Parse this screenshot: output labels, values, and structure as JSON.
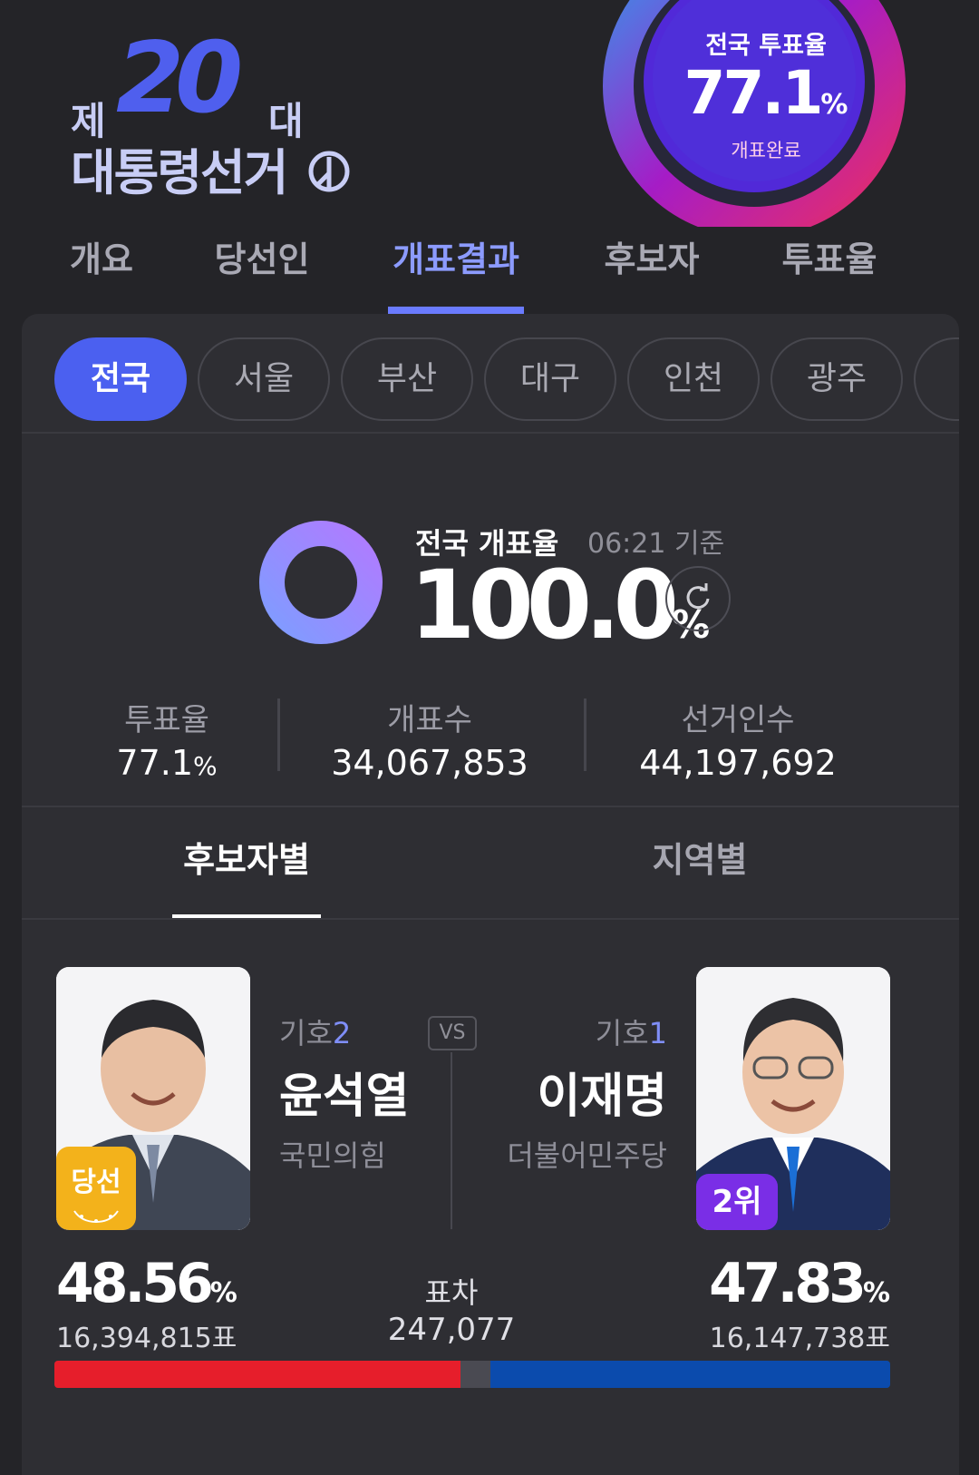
{
  "header": {
    "logo_prefix": "제",
    "logo_number": "20",
    "logo_suffix": "대",
    "logo_title": "대통령선거",
    "turnout_label": "전국 투표율",
    "turnout_value": "77.1",
    "turnout_unit": "%",
    "turnout_status": "개표완료"
  },
  "nav": {
    "tabs": [
      {
        "label": "개요"
      },
      {
        "label": "당선인"
      },
      {
        "label": "개표결과"
      },
      {
        "label": "후보자"
      },
      {
        "label": "투표율"
      }
    ],
    "active": "개표결과"
  },
  "regions": {
    "items": [
      {
        "label": "전국"
      },
      {
        "label": "서울"
      },
      {
        "label": "부산"
      },
      {
        "label": "대구"
      },
      {
        "label": "인천"
      },
      {
        "label": "광주"
      }
    ],
    "active": "전국"
  },
  "count": {
    "label": "전국 개표율",
    "time": "06:21 기준",
    "value": "100.0",
    "unit": "%",
    "progress": 1.0,
    "stats": [
      {
        "label": "투표율",
        "value": "77.1",
        "unit": "%"
      },
      {
        "label": "개표수",
        "value": "34,067,853"
      },
      {
        "label": "선거인수",
        "value": "44,197,692"
      }
    ]
  },
  "sub_tabs": {
    "tabs": [
      {
        "label": "후보자별"
      },
      {
        "label": "지역별"
      }
    ],
    "active": "후보자별"
  },
  "candidates": {
    "left": {
      "giho_label": "기호",
      "giho_number": "2",
      "name": "윤석열",
      "party": "국민의힘",
      "badge": "당선",
      "percent": "48.56",
      "percent_unit": "%",
      "votes": "16,394,815표",
      "share": 48.56,
      "bar_color": "#e61e2b"
    },
    "right": {
      "giho_label": "기호",
      "giho_number": "1",
      "name": "이재명",
      "party": "더불어민주당",
      "badge": "2위",
      "percent": "47.83",
      "percent_unit": "%",
      "votes": "16,147,738표",
      "share": 47.83,
      "bar_color": "#0b4bad"
    },
    "vs": "VS",
    "gap_label": "표차",
    "gap_value": "247,077"
  },
  "icons": {
    "refresh": "refresh-icon",
    "ballot_mark": "ballot-stamp-icon",
    "wreath": "laurel-wreath-icon"
  }
}
